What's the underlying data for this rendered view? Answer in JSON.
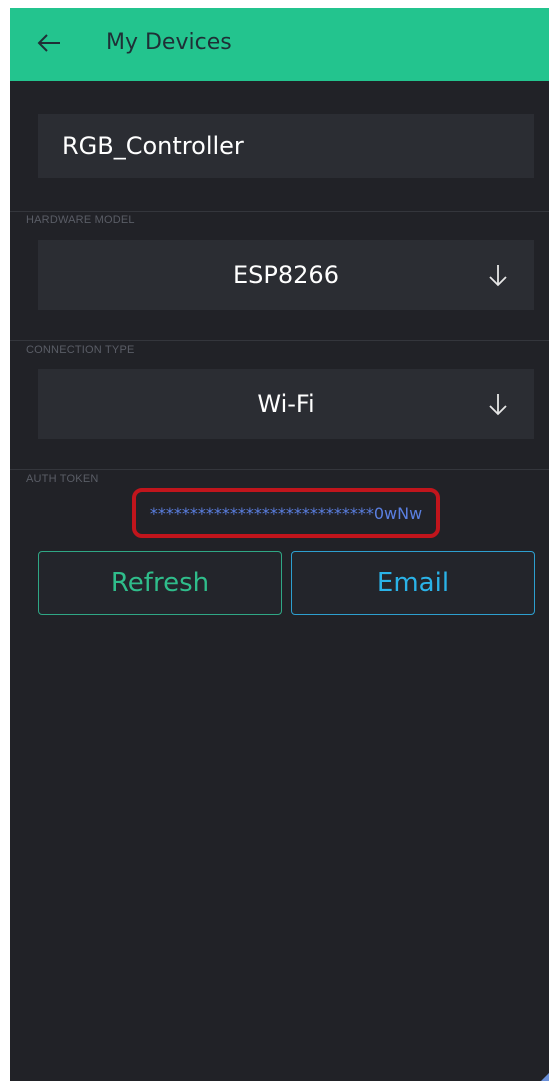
{
  "appbar": {
    "title": "My Devices",
    "back_icon": "arrow-left-icon",
    "color": "#23c48e"
  },
  "device": {
    "name": "RGB_Controller"
  },
  "hardware": {
    "label": "HARDWARE MODEL",
    "value": "ESP8266",
    "icon": "arrow-down-icon"
  },
  "connection": {
    "label": "CONNECTION TYPE",
    "value": "Wi-Fi",
    "icon": "arrow-down-icon"
  },
  "auth": {
    "label": "AUTH TOKEN",
    "token": "****************************0wNw",
    "highlight_color": "#c1151c"
  },
  "actions": {
    "refresh_label": "Refresh",
    "email_label": "Email",
    "refresh_color": "#2fbd8b",
    "email_color": "#2ab3e8"
  },
  "theme": {
    "background": "#212227",
    "field_background": "#2b2d33"
  }
}
